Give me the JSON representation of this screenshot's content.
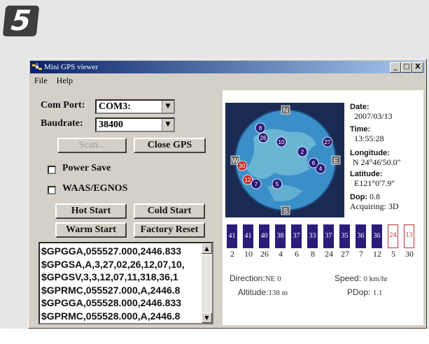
{
  "step": {
    "number": "5"
  },
  "window": {
    "title": "Mini GPS viewer",
    "controls": [
      "_",
      "□",
      "X"
    ],
    "menu": [
      "File",
      "Help"
    ]
  },
  "connection": {
    "com_port_label": "Com Port:",
    "com_port_value": "COM3:",
    "baudrate_label": "Baudrate:",
    "baudrate_value": "38400",
    "scan_label": "Scan...",
    "close_gps_label": "Close GPS"
  },
  "options": {
    "power_save_label": "Power Save",
    "power_save_checked": false,
    "waas_label": "WAAS/EGNOS",
    "waas_checked": false
  },
  "restart_buttons": {
    "hot_start": "Hot Start",
    "cold_start": "Cold Start",
    "warm_start": "Warm Start",
    "factory_reset": "Factory Reset"
  },
  "nmea_lines": [
    "$GPGGA,055527.000,2446.833",
    "$GPGSA,A,3,27,02,26,12,07,10,",
    "$GPGSV,3,3,12,07,11,318,36,1",
    "$GPRMC,055527.000,A,2446.8",
    "$GPGGA,055528.000,2446.833",
    "$GPRMC,055528.000,A,2446.8"
  ],
  "sky_view": {
    "compass": {
      "north": "N",
      "east": "E",
      "south": "S",
      "west": "W"
    },
    "colors": {
      "globe": "#3a8fc8",
      "land": "#7fc4d8",
      "fixed": "#2c1b79",
      "acquiring": "#c03030"
    },
    "satellites": [
      {
        "prn": "8",
        "status": "fixed"
      },
      {
        "prn": "26",
        "status": "fixed"
      },
      {
        "prn": "10",
        "status": "fixed"
      },
      {
        "prn": "2",
        "status": "fixed"
      },
      {
        "prn": "27",
        "status": "fixed"
      },
      {
        "prn": "4",
        "status": "fixed"
      },
      {
        "prn": "6",
        "status": "fixed"
      },
      {
        "prn": "30",
        "status": "acquiring"
      },
      {
        "prn": "12",
        "status": "acquiring"
      },
      {
        "prn": "7",
        "status": "fixed"
      },
      {
        "prn": "5",
        "status": "fixed"
      }
    ]
  },
  "gps_info": {
    "date_label": "Date:",
    "date_value": "2007/03/13",
    "time_label": "Time:",
    "time_value": "13:55:28",
    "longitude_label": "Longitude:",
    "longitude_value": "N 24°46'50.0\"",
    "latitude_label": "Latitude:",
    "latitude_value": "E121°0'7.9\"",
    "dop_label": "Dop:",
    "dop_value": "0.8",
    "acquiring_text": "Acquiring: 3D"
  },
  "signal_bars": [
    {
      "value": "41",
      "prn": "2",
      "status": "fixed"
    },
    {
      "value": "41",
      "prn": "10",
      "status": "fixed"
    },
    {
      "value": "40",
      "prn": "26",
      "status": "fixed"
    },
    {
      "value": "38",
      "prn": "4",
      "status": "fixed"
    },
    {
      "value": "37",
      "prn": "6",
      "status": "fixed"
    },
    {
      "value": "33",
      "prn": "8",
      "status": "fixed"
    },
    {
      "value": "37",
      "prn": "24",
      "status": "fixed"
    },
    {
      "value": "35",
      "prn": "27",
      "status": "fixed"
    },
    {
      "value": "36",
      "prn": "7",
      "status": "fixed"
    },
    {
      "value": "36",
      "prn": "12",
      "status": "fixed"
    },
    {
      "value": "24",
      "prn": "5",
      "status": "acquiring"
    },
    {
      "value": "13",
      "prn": "30",
      "status": "acquiring"
    }
  ],
  "status": {
    "direction_label": "Direction:",
    "direction_value": "NE 0",
    "speed_label": "Speed:",
    "speed_value": "0 km/hr",
    "altitude_label": "Altitude:",
    "altitude_value": "138 m",
    "pdop_label": "PDop:",
    "pdop_value": "1.1"
  }
}
